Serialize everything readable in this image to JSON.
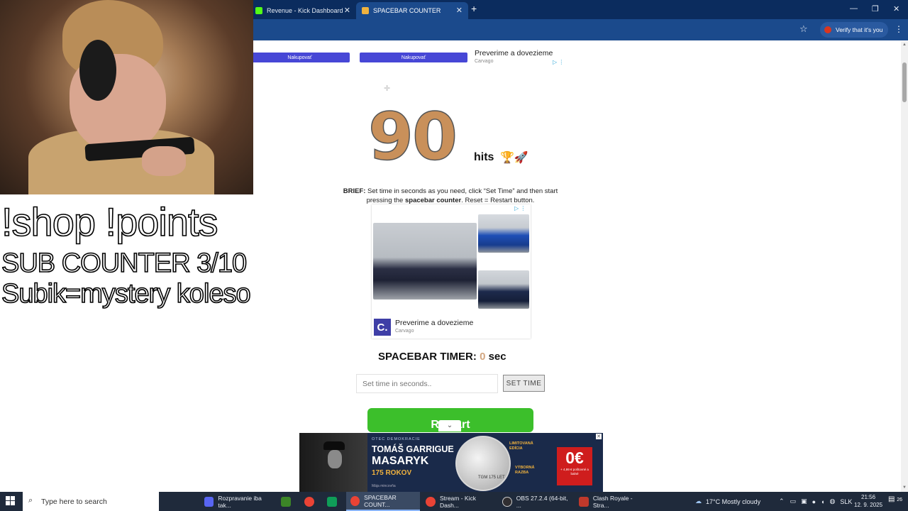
{
  "browser": {
    "tabs": [
      {
        "label": "Revenue - Kick Dashboard",
        "active": false
      },
      {
        "label": "SPACEBAR COUNTER",
        "active": true
      }
    ],
    "new_tab": "+",
    "window_buttons": [
      "—",
      "❐",
      "✕"
    ],
    "profile_button": "Verify that it's you"
  },
  "page": {
    "top_ads": {
      "buttons": [
        "Nakupovať",
        "Nakupovať"
      ],
      "ad_title": "Preverime a dovezieme",
      "ad_source": "Carvago"
    },
    "counter": {
      "value": "90",
      "unit": "hits",
      "emoji": "🏆🚀"
    },
    "brief": {
      "label": "BRIEF:",
      "text_a": " Set time in seconds as you need, click “Set Time” and then start pressing the ",
      "bold_term": "spacebar counter",
      "text_b": ". Reset = Restart button."
    },
    "mid_ad": {
      "logo": "C.",
      "title": "Preverime a dovezieme",
      "source": "Carvago"
    },
    "timer": {
      "label": "SPACEBAR TIMER:",
      "value": "0",
      "unit": "sec"
    },
    "time_input": {
      "placeholder": "Set time in seconds.."
    },
    "set_time_button": "SET TIME",
    "restart_button": "Restart",
    "collapse_button": "⌄",
    "banner_ad": {
      "kicker": "OTEC DEMOKRACIE",
      "name1": "TOMÁŠ GARRIGUE",
      "name2": "MASARYK",
      "years": "175 ROKOV",
      "coin_label": "TGM 175 LET",
      "edition": "LIMITOVANÁ EDÍCIA",
      "mint": "VÝBORNÁ RAZBA",
      "price": "0€",
      "price_note": "+ 4,99 € poštovné a balné",
      "brand": "Mája mincovňa",
      "close": "✕"
    }
  },
  "overlay": {
    "line1": "!shop !points",
    "line2": "SUB COUNTER 3/10",
    "line3": "Subik=mystery koleso"
  },
  "taskbar": {
    "search_placeholder": "Type here to search",
    "apps": [
      {
        "label": "Rozpravanie iba tak...",
        "color": "#5865f2"
      },
      {
        "label": "",
        "color": "#3c8527"
      },
      {
        "label": "",
        "color": "#ea4335"
      },
      {
        "label": "",
        "color": "#0f9d58"
      },
      {
        "label": "SPACEBAR COUNT...",
        "color": "#ea4335"
      },
      {
        "label": "Stream - Kick Dash...",
        "color": "#ea4335"
      },
      {
        "label": "OBS 27.2.4 (64-bit, ...",
        "color": "#302e31"
      },
      {
        "label": "Clash Royale - Stra...",
        "color": "#c0392b"
      }
    ],
    "weather": "17°C  Mostly cloudy",
    "language": "SLK",
    "time": "21:56",
    "date": "12. 9. 2025",
    "notifications": "26"
  }
}
